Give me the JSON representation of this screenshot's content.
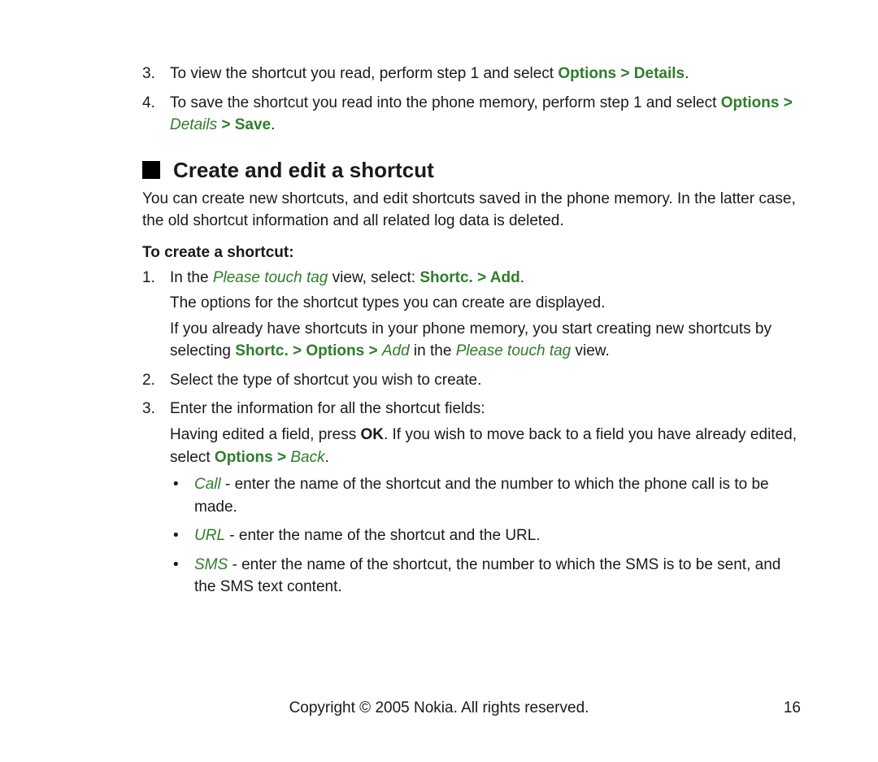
{
  "top_list_start": 3,
  "top_list": [
    {
      "num": "3.",
      "runs": [
        {
          "t": "To view the shortcut you read, perform step 1 and select ",
          "cls": ""
        },
        {
          "t": "Options",
          "cls": "green-b"
        },
        {
          "t": " > ",
          "cls": "green-b"
        },
        {
          "t": "Details",
          "cls": "green-b"
        },
        {
          "t": ".",
          "cls": ""
        }
      ]
    },
    {
      "num": "4.",
      "runs": [
        {
          "t": "To save the shortcut you read into the phone memory, perform step 1 and select ",
          "cls": ""
        },
        {
          "t": "Options",
          "cls": "green-b"
        },
        {
          "t": " > ",
          "cls": "green-b"
        },
        {
          "t": "Details",
          "cls": "green-i"
        },
        {
          "t": " > ",
          "cls": "green-b"
        },
        {
          "t": "Save",
          "cls": "green-b"
        },
        {
          "t": ".",
          "cls": ""
        }
      ]
    }
  ],
  "heading": "Create and edit a shortcut",
  "intro": "You can create new shortcuts, and edit shortcuts saved in the phone memory. In the latter case, the old shortcut information and all related log data is deleted.",
  "subheading": "To create a shortcut:",
  "create_list": [
    {
      "num": "1.",
      "para1": [
        {
          "t": "In the ",
          "cls": ""
        },
        {
          "t": "Please touch tag",
          "cls": "green-i"
        },
        {
          "t": " view, select: ",
          "cls": ""
        },
        {
          "t": "Shortc.",
          "cls": "green-b"
        },
        {
          "t": " > ",
          "cls": "green-b"
        },
        {
          "t": "Add",
          "cls": "green-b"
        },
        {
          "t": ".",
          "cls": ""
        }
      ],
      "para2": [
        {
          "t": "The options for the shortcut types you can create are displayed.",
          "cls": ""
        }
      ],
      "para3": [
        {
          "t": "If you already have shortcuts in your phone memory, you start creating new shortcuts by selecting ",
          "cls": ""
        },
        {
          "t": "Shortc.",
          "cls": "green-b"
        },
        {
          "t": " > ",
          "cls": "green-b"
        },
        {
          "t": "Options",
          "cls": "green-b"
        },
        {
          "t": " > ",
          "cls": "green-b"
        },
        {
          "t": "Add",
          "cls": "green-i"
        },
        {
          "t": " in the ",
          "cls": ""
        },
        {
          "t": "Please touch tag",
          "cls": "green-i"
        },
        {
          "t": " view.",
          "cls": ""
        }
      ]
    },
    {
      "num": "2.",
      "para1": [
        {
          "t": "Select the type of shortcut you wish to create.",
          "cls": ""
        }
      ]
    },
    {
      "num": "3.",
      "para1": [
        {
          "t": "Enter the information for all the shortcut fields:",
          "cls": ""
        }
      ],
      "para2": [
        {
          "t": "Having edited a field, press ",
          "cls": ""
        },
        {
          "t": "OK",
          "cls": "black-b"
        },
        {
          "t": ". If you wish to move back to a field you have already edited, select ",
          "cls": ""
        },
        {
          "t": "Options",
          "cls": "green-b"
        },
        {
          "t": " > ",
          "cls": "green-b"
        },
        {
          "t": "Back",
          "cls": "green-i"
        },
        {
          "t": ".",
          "cls": ""
        }
      ],
      "bullets": [
        [
          {
            "t": "Call",
            "cls": "green-i"
          },
          {
            "t": " - enter the name of the shortcut and the number to which the phone call is to be made.",
            "cls": ""
          }
        ],
        [
          {
            "t": "URL",
            "cls": "green-i"
          },
          {
            "t": " - enter the name of the shortcut and the URL.",
            "cls": ""
          }
        ],
        [
          {
            "t": "SMS",
            "cls": "green-i"
          },
          {
            "t": " - enter the name of the shortcut, the number to which the SMS is to be sent, and the SMS text content.",
            "cls": ""
          }
        ]
      ]
    }
  ],
  "footer": "Copyright © 2005 Nokia. All rights reserved.",
  "page_number": "16"
}
